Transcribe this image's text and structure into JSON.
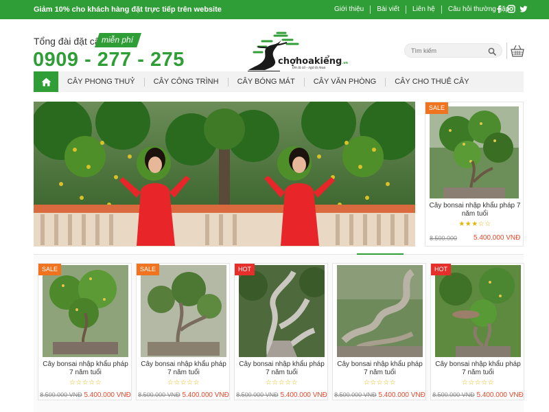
{
  "topbar": {
    "promo": "Giảm 10% cho khách hàng đặt trực tiếp trên website",
    "links": [
      "Giới thiệu",
      "Bài viết",
      "Liên hệ",
      "Câu hỏi thường gặp"
    ]
  },
  "header": {
    "hotline_label": "Tổng đài đặt cây",
    "free_label": "miễn phí",
    "hotline_number": "0909 - 277 - 275",
    "logo_text": "chợhoakiểng",
    "logo_suffix": ".vn",
    "logo_tagline": "tìm là có - ngó là mua",
    "search_placeholder": "Tìm kiếm"
  },
  "nav": {
    "items": [
      "CÂY PHONG THUỶ",
      "CÂY CÔNG TRÌNH",
      "CÂY BÓNG MÁT",
      "CÂY VĂN PHÒNG",
      "CÂY CHO THUÊ CÂY"
    ]
  },
  "side_product": {
    "badge": "SALE",
    "name": "Cây bonsai nhập khẩu pháp 7 năm tuổi",
    "stars": "★★★☆☆",
    "old_price": "8.500.000",
    "new_price": "5.400.000 VNĐ"
  },
  "products": [
    {
      "badge": "SALE",
      "name": "Cây bonsai nhập khẩu pháp 7 năm tuổi",
      "stars": "☆☆☆☆☆",
      "old_price": "8.500.000 VNĐ",
      "new_price": "5.400.000 VNĐ"
    },
    {
      "badge": "SALE",
      "name": "Cây bonsai nhập khẩu pháp 7 năm tuổi",
      "stars": "☆☆☆☆☆",
      "old_price": "8.500.000 VNĐ",
      "new_price": "5.400.000 VNĐ"
    },
    {
      "badge": "HOT",
      "name": "Cây bonsai nhập khẩu pháp 7 năm tuổi",
      "stars": "☆☆☆☆☆",
      "old_price": "8.500.000 VNĐ",
      "new_price": "5.400.000 VNĐ"
    },
    {
      "badge": "",
      "name": "Cây bonsai nhập khẩu pháp 7 năm tuổi",
      "stars": "☆☆☆☆☆",
      "old_price": "8.500.000 VNĐ",
      "new_price": "5.400.000 VNĐ"
    },
    {
      "badge": "HOT",
      "name": "Cây bonsai nhập khẩu pháp 7 năm tuổi",
      "stars": "☆☆☆☆☆",
      "old_price": "8.500.000 VNĐ",
      "new_price": "5.400.000 VNĐ"
    }
  ],
  "colors": {
    "brand_green": "#2f9e36",
    "sale_orange": "#f0741f",
    "hot_red": "#e62f2a",
    "price_red": "#e8462a",
    "star_yellow": "#e4b400"
  },
  "icons": [
    "facebook-icon",
    "instagram-icon",
    "twitter-icon",
    "search-icon",
    "cart-icon",
    "home-icon"
  ]
}
